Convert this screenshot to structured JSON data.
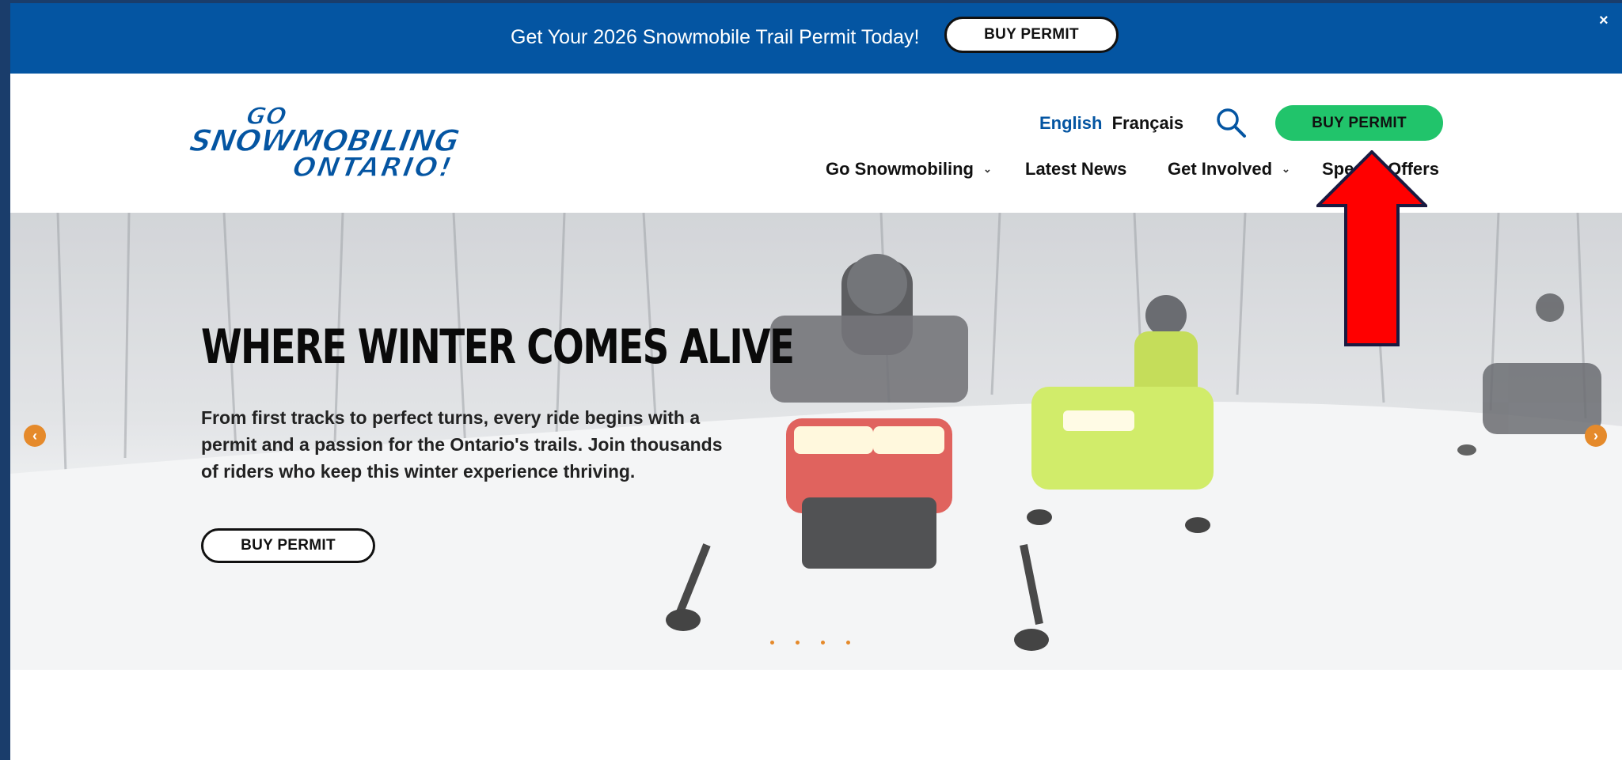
{
  "promo": {
    "text": "Get Your 2026 Snowmobile Trail Permit Today!",
    "button": "BUY PERMIT",
    "close": "×"
  },
  "header": {
    "logo_icon": "go-snowmobiling-ontario-logo",
    "lang_english": "English",
    "lang_french": "Français",
    "search_icon": "search-icon",
    "buy_button": "BUY PERMIT",
    "nav": [
      {
        "label": "Go Snowmobiling",
        "chevron": "⌄"
      },
      {
        "label": "Latest News"
      },
      {
        "label": "Get Involved",
        "chevron": "⌄"
      },
      {
        "label": "Special Offers"
      }
    ]
  },
  "hero": {
    "title": "WHERE WINTER COMES ALIVE",
    "body": "From first tracks to perfect turns, every ride begins with a permit and a passion for the Ontario's trails. Join thousands of riders who keep this winter experience thriving.",
    "button": "BUY PERMIT",
    "prev_icon": "‹",
    "next_icon": "›",
    "slide_count": 4
  },
  "colors": {
    "promo_bg": "#0455a2",
    "buy_green": "#21c46b",
    "link_blue": "#0455a2",
    "carousel_orange": "#e58a2b",
    "annotation_red": "#ff0000"
  }
}
